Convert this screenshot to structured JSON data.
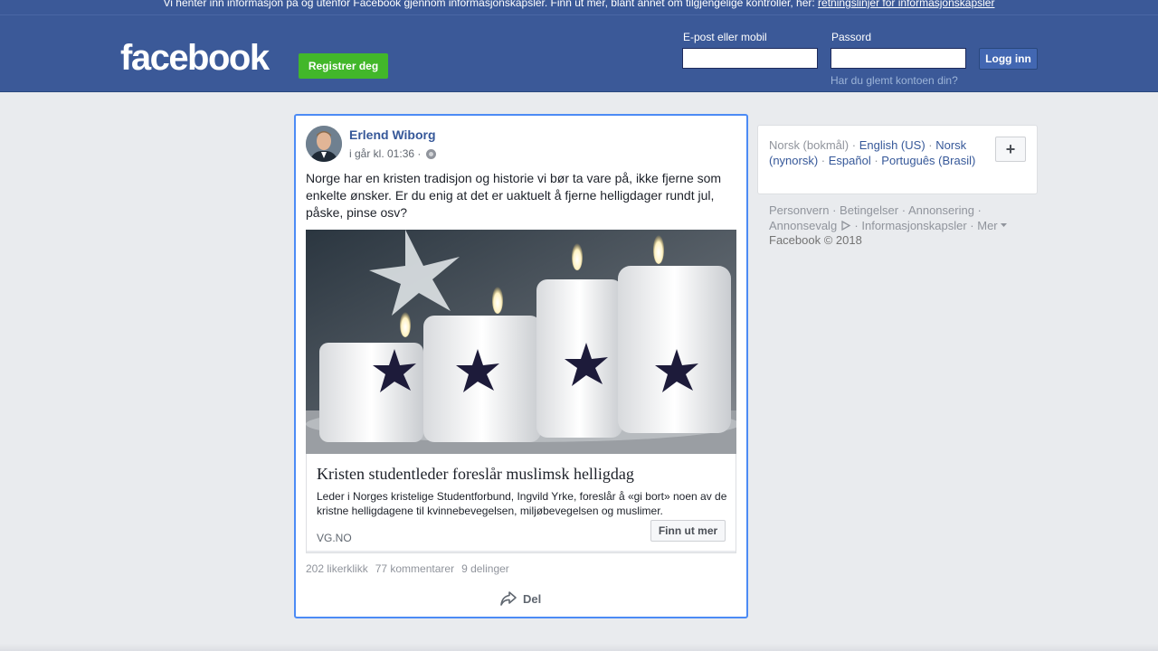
{
  "cookie_bar": {
    "text": "Vi henter inn informasjon på og utenfor Facebook gjennom informasjonskapsler. Finn ut mer, blant annet om tilgjengelige kontroller, her: ",
    "link": "retningslinjer for informasjonskapsler"
  },
  "header": {
    "logo": "facebook",
    "register_label": "Registrer deg",
    "email_label": "E-post eller mobil",
    "password_label": "Passord",
    "login_label": "Logg inn",
    "forgot_label": "Har du glemt kontoen din?"
  },
  "post": {
    "author": "Erlend Wiborg",
    "time": "i går kl. 01:36 ·",
    "text": "Norge har en kristen tradisjon og historie vi bør ta vare på, ikke fjerne som enkelte ønsker. Er du enig at det er uaktuelt å fjerne helligdager rundt jul, påske, pinse osv?",
    "link": {
      "title": "Kristen studentleder foreslår muslimsk helligdag",
      "description": "Leder i Norges kristelige Studentforbund, Ingvild Yrke, foreslår å «gi bort» noen av de kristne helligdagene til kvinnebevegelsen, miljøbevegelsen og muslimer.",
      "domain": "VG.NO",
      "button": "Finn ut mer"
    },
    "stats": {
      "likes": "202 likerklikk",
      "comments": "77 kommentarer",
      "shares": "9 delinger"
    },
    "share_label": "Del"
  },
  "languages": {
    "current": "Norsk (bokmål)",
    "options": [
      "English (US)",
      "Norsk (nynorsk)",
      "Español",
      "Português (Brasil)"
    ],
    "add_label": "+"
  },
  "footer": {
    "links": [
      "Personvern",
      "Betingelser",
      "Annonsering",
      "Annonsevalg",
      "Informasjonskapsler",
      "Mer"
    ],
    "copyright": "Facebook © 2018"
  },
  "colors": {
    "brand": "#3b5998",
    "link": "#365899",
    "register_green": "#42b72a"
  }
}
